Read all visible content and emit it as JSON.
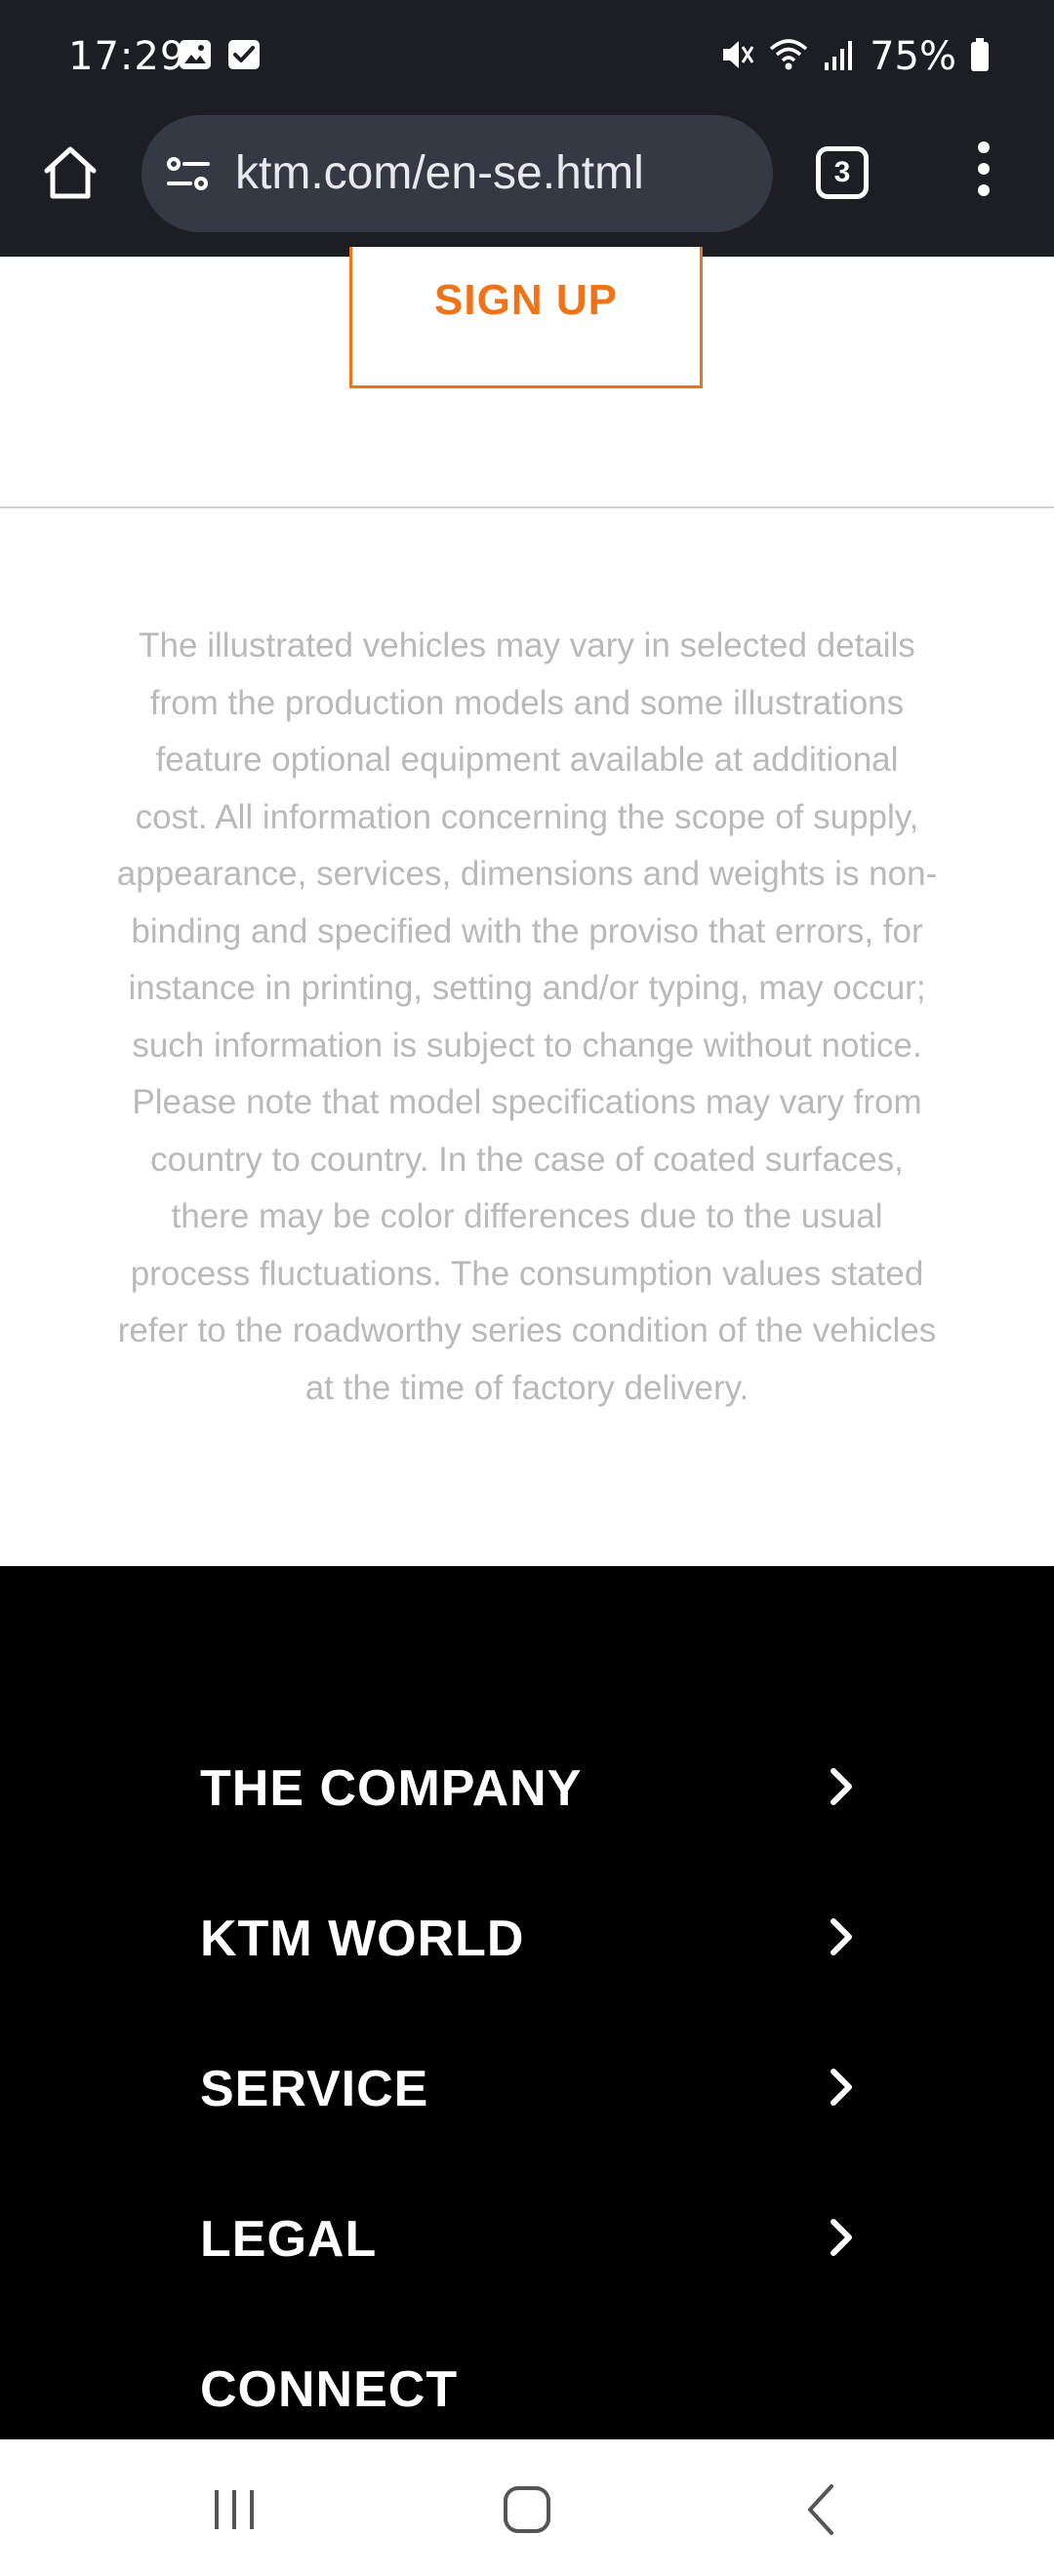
{
  "status_bar": {
    "time": "17:29",
    "left_icons": [
      "gallery-icon",
      "checkbox-icon"
    ],
    "right_icons": [
      "mute-icon",
      "wifi-icon",
      "signal-icon"
    ],
    "battery_percent": "75%"
  },
  "browser": {
    "url": "ktm.com/en-se.html",
    "tab_count": "3"
  },
  "content": {
    "signup_label": "SIGN UP",
    "disclaimer_lines": [
      "The illustrated vehicles may vary in selected details",
      "from the production models and some illustrations",
      "feature optional equipment available at additional",
      "cost. All information concerning the scope of supply,",
      "appearance, services, dimensions and weights is non-",
      "binding and specified with the proviso that errors, for",
      "instance in printing, setting and/or typing, may occur;",
      "such information is subject to change without notice.",
      "Please note that model specifications may vary from",
      "country to country. In the case of coated surfaces,",
      "there may be color differences due to the usual",
      "process fluctuations. The consumption values stated",
      "refer to the roadworthy series condition of the vehicles",
      "at the time of factory delivery."
    ]
  },
  "footer": {
    "items": [
      {
        "label": "THE COMPANY"
      },
      {
        "label": "KTM WORLD"
      },
      {
        "label": "SERVICE"
      },
      {
        "label": "LEGAL"
      },
      {
        "label": "CONNECT"
      }
    ]
  },
  "colors": {
    "accent": "#f07318",
    "chrome_bg": "#1c1e24",
    "url_pill_bg": "#353944",
    "disclaimer_text": "#b9b9b9",
    "footer_bg": "#000000"
  }
}
